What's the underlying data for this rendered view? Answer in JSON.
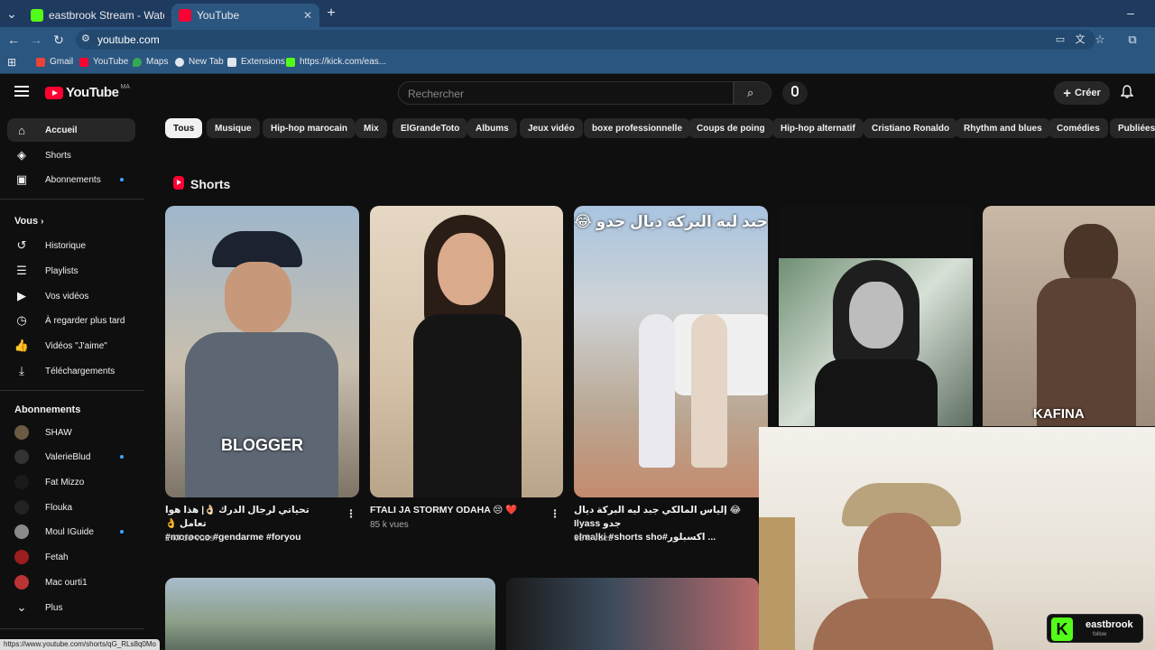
{
  "browser": {
    "tabs": [
      {
        "title": "eastbrook Stream - Watch Live",
        "active": false
      },
      {
        "title": "YouTube",
        "active": true
      }
    ],
    "url": "youtube.com",
    "bookmarks": [
      "Gmail",
      "YouTube",
      "Maps",
      "New Tab",
      "Extensions",
      "https://kick.com/eas..."
    ]
  },
  "youtube": {
    "logo": "YouTube",
    "region": "MA",
    "search_placeholder": "Rechercher",
    "create_label": "Créer",
    "sidebar": {
      "main": [
        "Accueil",
        "Shorts",
        "Abonnements"
      ],
      "vous_label": "Vous",
      "vous_items": [
        "Historique",
        "Playlists",
        "Vos vidéos",
        "À regarder plus tard",
        "Vidéos \"J'aime\"",
        "Téléchargements"
      ],
      "subs_label": "Abonnements",
      "subscriptions": [
        "SHAW",
        "ValerieBlud",
        "Fat Mizzo",
        "Flouka",
        "Moul IGuide",
        "Fetah",
        "Mac ourti1"
      ],
      "more_label": "Plus"
    },
    "chips": [
      "Tous",
      "Musique",
      "Hip-hop marocain",
      "Mix",
      "ElGrandeToto",
      "Albums",
      "Jeux vidéo",
      "boxe professionnelle",
      "Coups de poing",
      "Hip-hop alternatif",
      "Cristiano Ronaldo",
      "Rhythm and blues",
      "Comédies",
      "Publiées"
    ],
    "shorts_section": {
      "title": "Shorts",
      "items": [
        {
          "title_line1": "تحياتي لرجال الدرك 👌🏻| هذا هوا تعامل 👌",
          "title_line2": "#morocco #gendarme #foryou",
          "views": "2 M de vues",
          "overlay": "BLOGGER"
        },
        {
          "title_line1": "FTALI JA STORMY ODAHA 😔 ❤️",
          "title_line2": "",
          "views": "85 k vues",
          "overlay": ""
        },
        {
          "title_line1": "😂 إلياس المالكي جبد ليه البركة ديال جدو Ilyass",
          "title_line2": "elmalki #shorts sho#اكسبلور ...",
          "views": "98 k vues",
          "overlay": "جبد ليه البركة ديال جدو 😂"
        },
        {
          "title_line1": "",
          "title_line2": "",
          "views": "",
          "overlay": ""
        },
        {
          "title_line1": "",
          "title_line2": "",
          "views": "",
          "overlay": "KAFINA"
        }
      ]
    }
  },
  "stream_overlay": {
    "channel": "eastbrook",
    "sub": "follow"
  },
  "status_url": "https://www.youtube.com/shorts/qG_RLs8q0Mo"
}
